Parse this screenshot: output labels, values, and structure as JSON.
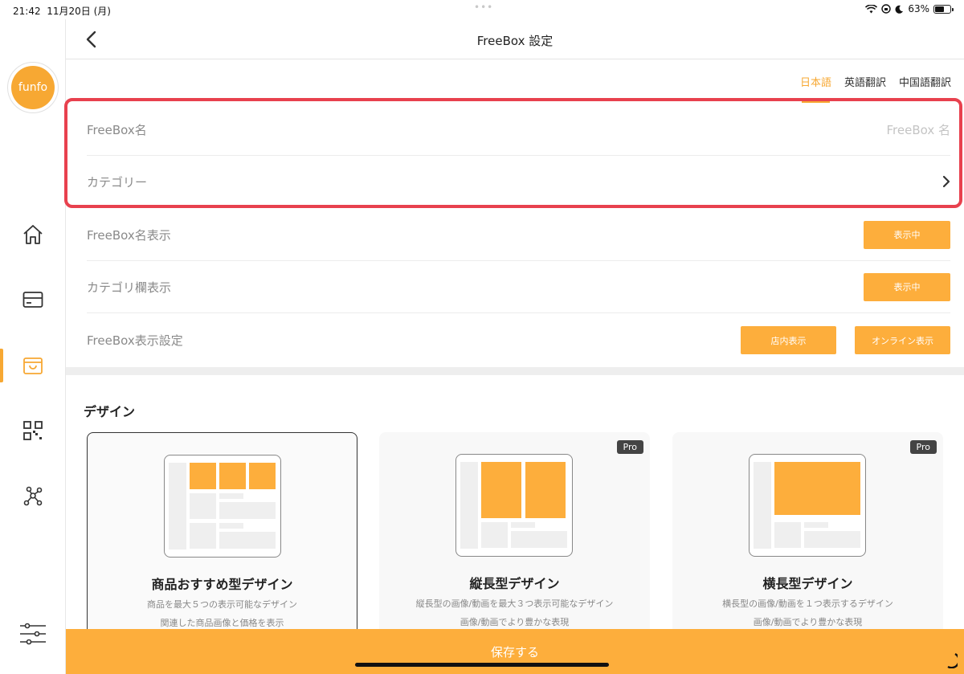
{
  "status": {
    "time": "21:42",
    "date": "11月20日 (月)",
    "battery": "63%",
    "battery_level": 0.63
  },
  "header": {
    "title": "FreeBox 設定",
    "back_icon": "chevron-left-icon"
  },
  "logo": {
    "text": "funfo"
  },
  "sidebar": {
    "items": [
      "home-icon",
      "card-icon",
      "shop-bag-icon",
      "qr-code-icon",
      "network-icon"
    ],
    "settings_icon": "sliders-icon",
    "active_index": 2
  },
  "lang_tabs": [
    "日本語",
    "英語翻訳",
    "中国語翻訳"
  ],
  "form": {
    "name_label": "FreeBox名",
    "name_placeholder": "FreeBox 名",
    "category_label": "カテゴリー",
    "name_display_label": "FreeBox名表示",
    "name_display_button": "表示中",
    "category_display_label": "カテゴリ欄表示",
    "category_display_button": "表示中",
    "display_setting_label": "FreeBox表示設定",
    "store_display_button": "店内表示",
    "online_display_button": "オンライン表示"
  },
  "design": {
    "title": "デザイン",
    "cards": [
      {
        "title": "商品おすすめ型デザイン",
        "desc1": "商品を最大５つの表示可能なデザイン",
        "desc2": "関連した商品画像と価格を表示",
        "pro": ""
      },
      {
        "title": "縦長型デザイン",
        "desc1": "縦長型の画像/動画を最大３つ表示可能なデザイン",
        "desc2": "画像/動画でより豊かな表現",
        "pro": "Pro"
      },
      {
        "title": "横長型デザイン",
        "desc1": "横長型の画像/動画を１つ表示するデザイン",
        "desc2": "画像/動画でより豊かな表現",
        "pro": "Pro"
      }
    ]
  },
  "save_button": "保存する",
  "colors": {
    "accent": "#fdae3c",
    "highlight": "#e8414e"
  }
}
